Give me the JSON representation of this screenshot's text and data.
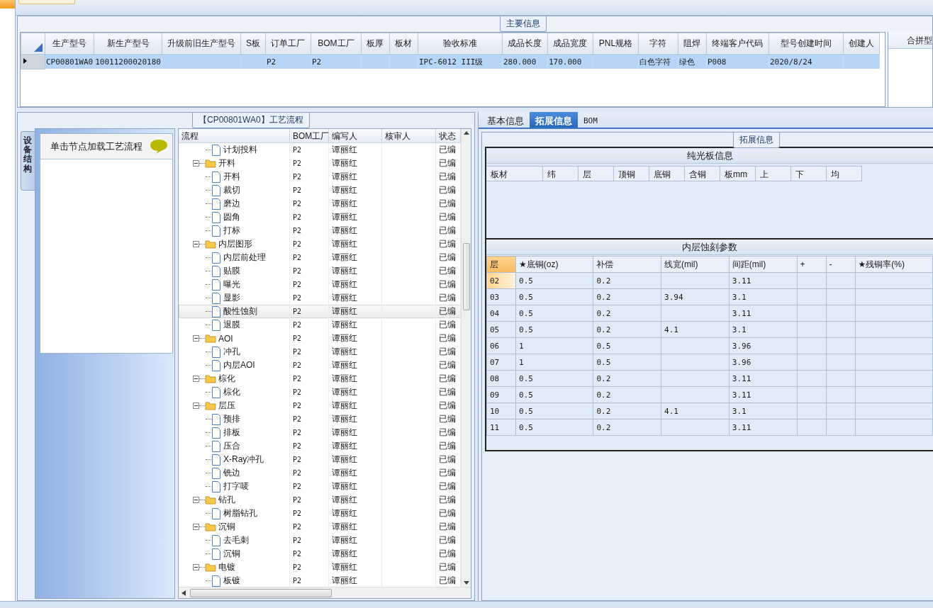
{
  "main_info": {
    "title": "主要信息",
    "columns": [
      "生产型号",
      "新生产型号",
      "升级前旧生产型号",
      "S板",
      "订单工厂",
      "BOM工厂",
      "板厚",
      "板材",
      "验收标准",
      "成品长度",
      "成品宽度",
      "PNL规格",
      "字符",
      "阻焊",
      "终端客户代码",
      "型号创建时间",
      "创建人"
    ],
    "rows": [
      {
        "selected": true,
        "cells": [
          "CP00801WA0",
          "10011200020180",
          "",
          "",
          "P2",
          "P2",
          "",
          "",
          "IPC-6012 III级",
          "280.000",
          "170.000",
          "",
          "白色字符",
          "绿色",
          "P008",
          "2020/8/24",
          ""
        ]
      }
    ],
    "merged_header": "合拼型"
  },
  "process_panel": {
    "title": "【CP00801WA0】工艺流程",
    "side_tab": "设备结构",
    "hint": "单击节点加载工艺流程",
    "columns": [
      "流程",
      "BOM工厂",
      "编写人",
      "核审人",
      "状态"
    ],
    "tree": [
      {
        "children": [
          {
            "label": "计划投料",
            "bom": "P2",
            "writer": "谭丽红",
            "status": "已编",
            "selected": false
          }
        ]
      },
      {
        "label": "开料",
        "bom": "P2",
        "writer": "谭丽红",
        "status": "已编",
        "selected": false,
        "expanded": true,
        "children": [
          {
            "label": "开料",
            "bom": "P2",
            "writer": "谭丽红",
            "status": "已编",
            "selected": false
          },
          {
            "label": "裁切",
            "bom": "P2",
            "writer": "谭丽红",
            "status": "已编",
            "selected": false
          },
          {
            "label": "磨边",
            "bom": "P2",
            "writer": "谭丽红",
            "status": "已编",
            "selected": false
          },
          {
            "label": "圆角",
            "bom": "P2",
            "writer": "谭丽红",
            "status": "已编",
            "selected": false
          },
          {
            "label": "打标",
            "bom": "P2",
            "writer": "谭丽红",
            "status": "已编",
            "selected": false
          }
        ]
      },
      {
        "label": "内层图形",
        "bom": "P2",
        "writer": "谭丽红",
        "status": "已编",
        "selected": false,
        "expanded": true,
        "children": [
          {
            "label": "内层前处理",
            "bom": "P2",
            "writer": "谭丽红",
            "status": "已编",
            "selected": false
          },
          {
            "label": "贴膜",
            "bom": "P2",
            "writer": "谭丽红",
            "status": "已编",
            "selected": false
          },
          {
            "label": "曝光",
            "bom": "P2",
            "writer": "谭丽红",
            "status": "已编",
            "selected": false
          },
          {
            "label": "显影",
            "bom": "P2",
            "writer": "谭丽红",
            "status": "已编",
            "selected": false
          },
          {
            "label": "酸性蚀刻",
            "bom": "P2",
            "writer": "谭丽红",
            "status": "已编",
            "selected": true
          },
          {
            "label": "退膜",
            "bom": "P2",
            "writer": "谭丽红",
            "status": "已编",
            "selected": false
          }
        ]
      },
      {
        "label": "AOI",
        "bom": "P2",
        "writer": "谭丽红",
        "status": "已编",
        "selected": false,
        "expanded": true,
        "children": [
          {
            "label": "冲孔",
            "bom": "P2",
            "writer": "谭丽红",
            "status": "已编",
            "selected": false
          },
          {
            "label": "内层AOI",
            "bom": "P2",
            "writer": "谭丽红",
            "status": "已编",
            "selected": false
          }
        ]
      },
      {
        "label": "棕化",
        "bom": "P2",
        "writer": "谭丽红",
        "status": "已编",
        "selected": false,
        "expanded": true,
        "children": [
          {
            "label": "棕化",
            "bom": "P2",
            "writer": "谭丽红",
            "status": "已编",
            "selected": false
          }
        ]
      },
      {
        "label": "层压",
        "bom": "P2",
        "writer": "谭丽红",
        "status": "已编",
        "selected": false,
        "expanded": true,
        "children": [
          {
            "label": "预排",
            "bom": "P2",
            "writer": "谭丽红",
            "status": "已编",
            "selected": false
          },
          {
            "label": "排板",
            "bom": "P2",
            "writer": "谭丽红",
            "status": "已编",
            "selected": false
          },
          {
            "label": "压合",
            "bom": "P2",
            "writer": "谭丽红",
            "status": "已编",
            "selected": false
          },
          {
            "label": "X-Ray冲孔",
            "bom": "P2",
            "writer": "谭丽红",
            "status": "已编",
            "selected": false
          },
          {
            "label": "铣边",
            "bom": "P2",
            "writer": "谭丽红",
            "status": "已编",
            "selected": false
          },
          {
            "label": "打字唛",
            "bom": "P2",
            "writer": "谭丽红",
            "status": "已编",
            "selected": false
          }
        ]
      },
      {
        "label": "钻孔",
        "bom": "P2",
        "writer": "谭丽红",
        "status": "已编",
        "selected": false,
        "expanded": true,
        "children": [
          {
            "label": "树脂钻孔",
            "bom": "P2",
            "writer": "谭丽红",
            "status": "已编",
            "selected": false
          }
        ]
      },
      {
        "label": "沉铜",
        "bom": "P2",
        "writer": "谭丽红",
        "status": "已编",
        "selected": false,
        "expanded": true,
        "children": [
          {
            "label": "去毛刺",
            "bom": "P2",
            "writer": "谭丽红",
            "status": "已编",
            "selected": false
          },
          {
            "label": "沉铜",
            "bom": "P2",
            "writer": "谭丽红",
            "status": "已编",
            "selected": false
          }
        ]
      },
      {
        "label": "电镀",
        "bom": "P2",
        "writer": "谭丽红",
        "status": "已编",
        "selected": false,
        "expanded": true,
        "children": [
          {
            "label": "板镀",
            "bom": "P2",
            "writer": "谭丽红",
            "status": "已编",
            "selected": false
          }
        ]
      }
    ]
  },
  "detail_panel": {
    "tabs": [
      {
        "label": "基本信息",
        "selected": false
      },
      {
        "label": "拓展信息",
        "selected": true
      },
      {
        "label": "BOM",
        "selected": false
      }
    ],
    "group_title": "拓展信息",
    "bare_board": {
      "title": "纯光板信息",
      "columns": [
        "板材",
        "纬",
        "层",
        "顶铜",
        "底铜",
        "含铜",
        "板mm",
        "上",
        "下",
        "均"
      ]
    },
    "etch_params": {
      "title": "内层蚀刻参数",
      "columns": [
        "层",
        "★底铜(oz)",
        "补偿",
        "线宽(mil)",
        "间距(mil)",
        "+",
        "-",
        "★残铜率(%)"
      ],
      "rows": [
        {
          "selected": true,
          "cells": [
            "02",
            "0.5",
            "0.2",
            "",
            "3.11",
            "",
            "",
            ""
          ]
        },
        {
          "selected": false,
          "cells": [
            "03",
            "0.5",
            "0.2",
            "3.94",
            "3.1",
            "",
            "",
            ""
          ]
        },
        {
          "selected": false,
          "cells": [
            "04",
            "0.5",
            "0.2",
            "",
            "3.11",
            "",
            "",
            ""
          ]
        },
        {
          "selected": false,
          "cells": [
            "05",
            "0.5",
            "0.2",
            "4.1",
            "3.1",
            "",
            "",
            ""
          ]
        },
        {
          "selected": false,
          "cells": [
            "06",
            "1",
            "0.5",
            "",
            "3.96",
            "",
            "",
            ""
          ]
        },
        {
          "selected": false,
          "cells": [
            "07",
            "1",
            "0.5",
            "",
            "3.96",
            "",
            "",
            ""
          ]
        },
        {
          "selected": false,
          "cells": [
            "08",
            "0.5",
            "0.2",
            "",
            "3.11",
            "",
            "",
            ""
          ]
        },
        {
          "selected": false,
          "cells": [
            "09",
            "0.5",
            "0.2",
            "",
            "3.11",
            "",
            "",
            ""
          ]
        },
        {
          "selected": false,
          "cells": [
            "10",
            "0.5",
            "0.2",
            "4.1",
            "3.1",
            "",
            "",
            ""
          ]
        },
        {
          "selected": false,
          "cells": [
            "11",
            "0.5",
            "0.2",
            "",
            "3.11",
            "",
            "",
            ""
          ]
        }
      ]
    }
  }
}
